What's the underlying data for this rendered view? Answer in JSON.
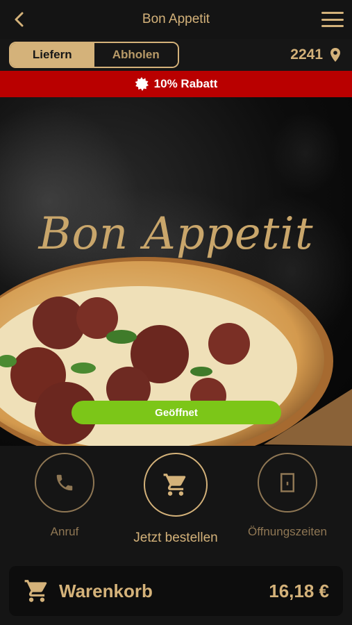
{
  "header": {
    "title": "Bon Appetit",
    "back_icon": "chevron-left-icon",
    "menu_icon": "hamburger-menu-icon"
  },
  "mode": {
    "deliver_label": "Liefern",
    "pickup_label": "Abholen",
    "selected": "Liefern"
  },
  "location": {
    "postal_code": "2241",
    "icon": "map-pin-icon"
  },
  "discount": {
    "label": "10% Rabatt",
    "icon": "badge-icon"
  },
  "hero": {
    "brand": "Bon Appetit",
    "status": "Geöffnet"
  },
  "actions": {
    "call_label": "Anruf",
    "order_label": "Jetzt bestellen",
    "hours_label": "Öffnungszeiten"
  },
  "cart": {
    "label": "Warenkorb",
    "total": "16,18 €",
    "icon": "cart-icon"
  },
  "colors": {
    "gold": "#d4b27a",
    "red": "#b90000",
    "green": "#7cc618",
    "background": "#151515"
  }
}
